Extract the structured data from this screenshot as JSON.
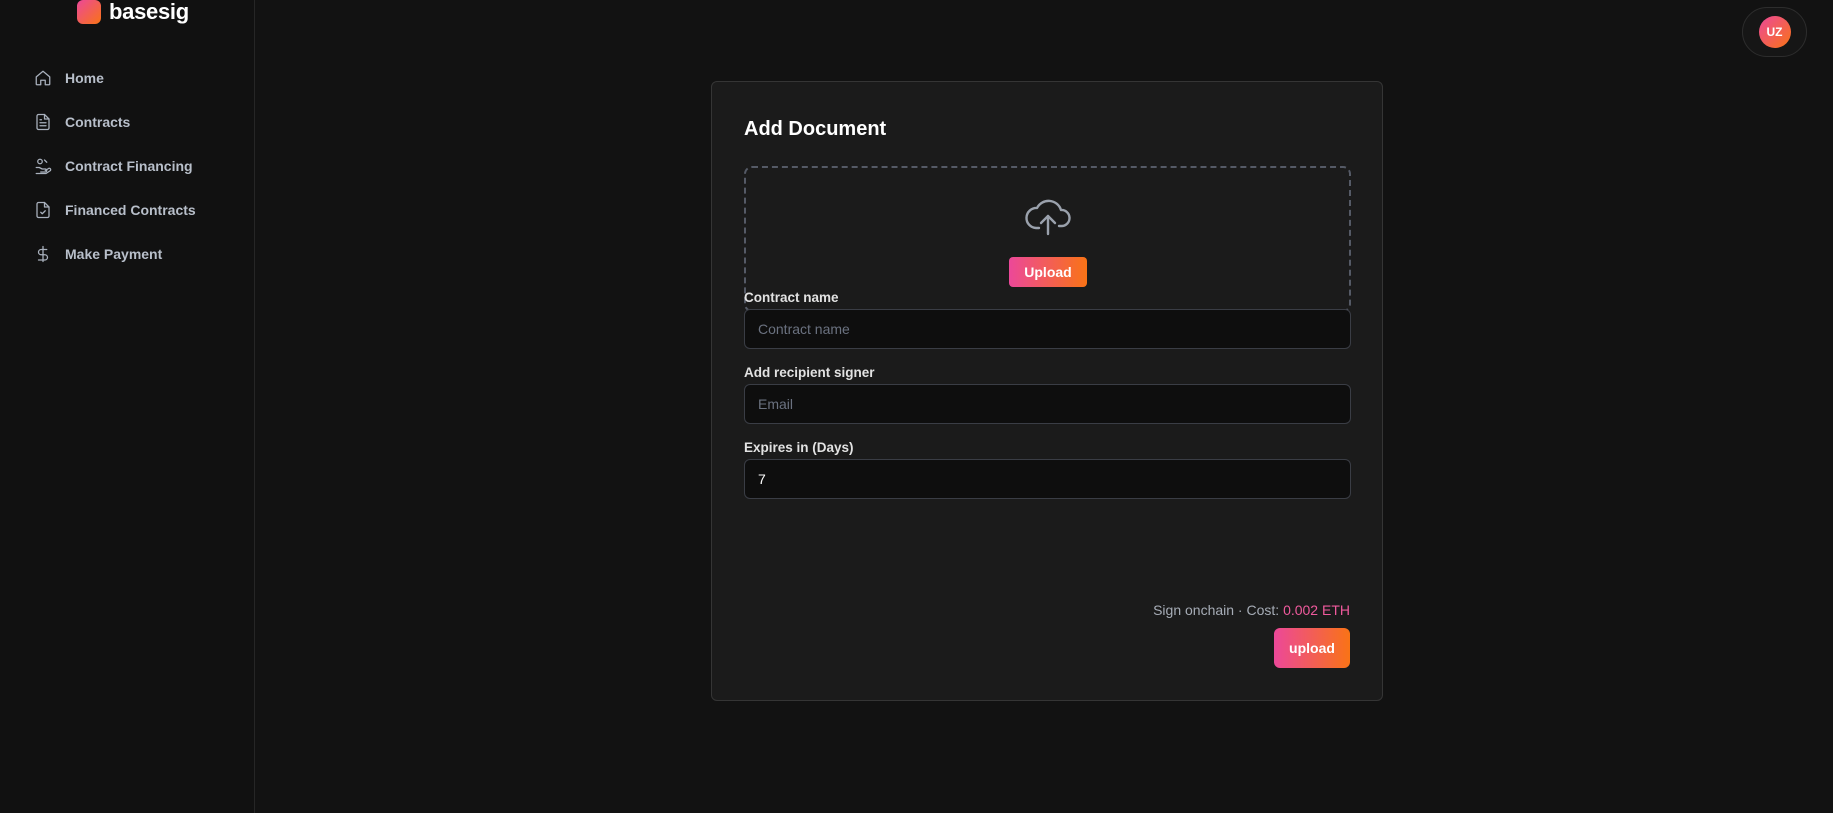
{
  "brand": {
    "name": "basesig"
  },
  "sidebar": {
    "items": [
      {
        "label": "Home",
        "icon": "home-icon"
      },
      {
        "label": "Contracts",
        "icon": "document-icon"
      },
      {
        "label": "Contract Financing",
        "icon": "hand-coins-icon"
      },
      {
        "label": "Financed Contracts",
        "icon": "document-check-icon"
      },
      {
        "label": "Make Payment",
        "icon": "dollar-icon"
      }
    ]
  },
  "user": {
    "initials": "UZ"
  },
  "form": {
    "title": "Add Document",
    "dropzone": {
      "icon": "cloud-upload-icon",
      "button_label": "Upload"
    },
    "contract_name": {
      "label": "Contract name",
      "placeholder": "Contract name",
      "value": ""
    },
    "recipient": {
      "label": "Add recipient signer",
      "placeholder": "Email",
      "value": ""
    },
    "expires": {
      "label": "Expires in (Days)",
      "value": "7"
    },
    "cost": {
      "prefix": "Sign onchain · Cost: ",
      "value": "0.002 ETH"
    },
    "submit_label": "upload"
  },
  "colors": {
    "background": "#121212",
    "card": "#1b1b1b",
    "accent_start": "#ec4899",
    "accent_end": "#f97316",
    "cost_value": "#f05a9d"
  }
}
